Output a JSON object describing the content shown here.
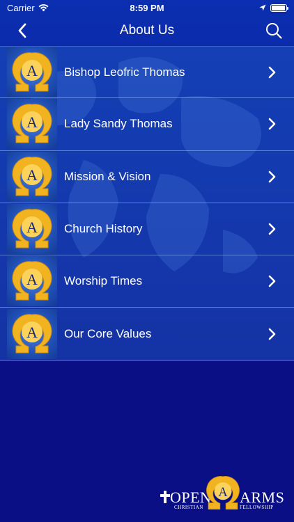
{
  "status_bar": {
    "carrier": "Carrier",
    "time": "8:59 PM"
  },
  "nav": {
    "title": "About Us"
  },
  "menu_items": [
    {
      "label": "Bishop Leofric Thomas"
    },
    {
      "label": "Lady Sandy Thomas"
    },
    {
      "label": "Mission & Vision"
    },
    {
      "label": "Church History"
    },
    {
      "label": "Worship Times"
    },
    {
      "label": "Our Core Values"
    }
  ],
  "footer_logo": {
    "word_left": "OPEN",
    "word_right": "ARMS",
    "sub_left": "CHRISTIAN",
    "sub_right": "FELLOWSHIP",
    "emblem_letter": "A"
  },
  "colors": {
    "background": "#0a0f86",
    "row": "#1e50be",
    "logo_gold": "#f2b321",
    "logo_navy": "#1a2a7a"
  }
}
